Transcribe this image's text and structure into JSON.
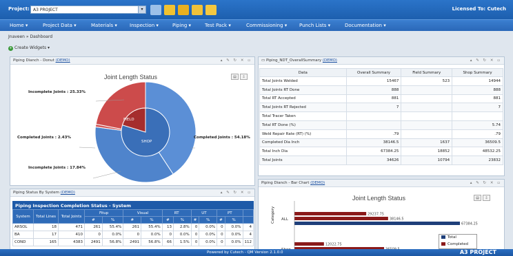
{
  "header": {
    "project_label": "Project:",
    "project_value": "A3 PROJECT",
    "licensed": "Licensed To: Cutech"
  },
  "menu": [
    "Home",
    "Project Data",
    "Materials",
    "Inspection",
    "Piping",
    "Test Pack",
    "Commissioning",
    "Punch Lists",
    "Documentation"
  ],
  "breadcrumb": "Jnaveen » Dashboard",
  "create_widgets": "Create Widgets",
  "donut_panel": {
    "title": "Piping Dianch - Donut",
    "demo": "(DEMO)",
    "chart_title": "Joint Length Status",
    "labels": {
      "inc_top": "Incomplete Joints : 25.33%",
      "comp_left": "Completed Joints : 2.43%",
      "inc_bottom": "Incomplete Joints : 17.84%",
      "comp_right": "Completed Joints : 54.18%",
      "field": "FIELD",
      "shop": "SHOP"
    }
  },
  "summary_panel": {
    "title": "Piping_NDT_OverallSummary",
    "demo": "(DEMO)",
    "columns": [
      "Data",
      "Overall Summary",
      "Field Summary",
      "Shop Summary"
    ],
    "rows": [
      [
        "Total Joints Welded",
        "15467",
        "523",
        "14944"
      ],
      [
        "Total Joints RT Done",
        "888",
        "",
        "888"
      ],
      [
        "Total RT Accepted",
        "881",
        "",
        "881"
      ],
      [
        "Total Joints RT Rejected",
        "7",
        "",
        "7"
      ],
      [
        "Total Tracer Taken",
        "",
        "",
        ""
      ],
      [
        "Total RT Done (%)",
        "",
        "",
        "5.74"
      ],
      [
        "Weld Repair Rate (RT) (%)",
        ".79",
        "",
        ".79"
      ],
      [
        "Completed Dia Inch",
        "38146.5",
        "1637",
        "36509.5"
      ],
      [
        "Total Inch Dia",
        "67384.25",
        "18852",
        "48532.25"
      ],
      [
        "Total Joints",
        "34626",
        "10794",
        "23832"
      ]
    ]
  },
  "status_panel": {
    "title": "Piping Status By System",
    "demo": "(DEMO)",
    "table_title": "Piping Inspection Completion Status - System",
    "group_headers": [
      "System",
      "Total Lines",
      "Total Joints",
      "Fitup",
      "Visual",
      "RT",
      "UT",
      "PT"
    ],
    "sub_headers": [
      "#",
      "%",
      "#",
      "%",
      "#",
      "%",
      "#",
      "%",
      "#",
      "%"
    ],
    "rows": [
      [
        "ARSOL",
        "18",
        "471",
        "261",
        "55.4%",
        "261",
        "55.4%",
        "13",
        "2.8%",
        "0",
        "0.0%",
        "0",
        "0.0%",
        "4"
      ],
      [
        "BA",
        "17",
        "410",
        "0",
        "0.0%",
        "0",
        "0.0%",
        "0",
        "0.0%",
        "0",
        "0.0%",
        "0",
        "0.0%",
        "4"
      ],
      [
        "COND",
        "165",
        "4383",
        "2491",
        "56.8%",
        "2491",
        "56.8%",
        "66",
        "1.5%",
        "0",
        "0.0%",
        "0",
        "0.0%",
        "112"
      ]
    ]
  },
  "bar_panel": {
    "title": "Piping Dianch - Bar Chart",
    "demo": "(DEMO)",
    "chart_title": "Joint Length Status",
    "ylabel": "Category"
  },
  "chart_data": {
    "type": "bar",
    "title": "Joint Length Status",
    "categories": [
      "ALL",
      "Shop"
    ],
    "series": [
      {
        "name": "Total",
        "values": [
          67384.25,
          48532.25
        ]
      },
      {
        "name": "Completed",
        "values": [
          38146.5,
          36509.5
        ]
      },
      {
        "name": "",
        "values": [
          29237.75,
          12022.75
        ]
      }
    ],
    "legend": [
      "Total",
      "Completed"
    ]
  },
  "footer": {
    "powered": "Powered by Cutech - QM Version 2.1.0.0",
    "project": "A3 PROJECT"
  },
  "colors": {
    "blue": "#2a5fa8",
    "red": "#8b1a1a",
    "donut_blue": "#5b8fd6",
    "donut_red": "#cc4b4b"
  }
}
